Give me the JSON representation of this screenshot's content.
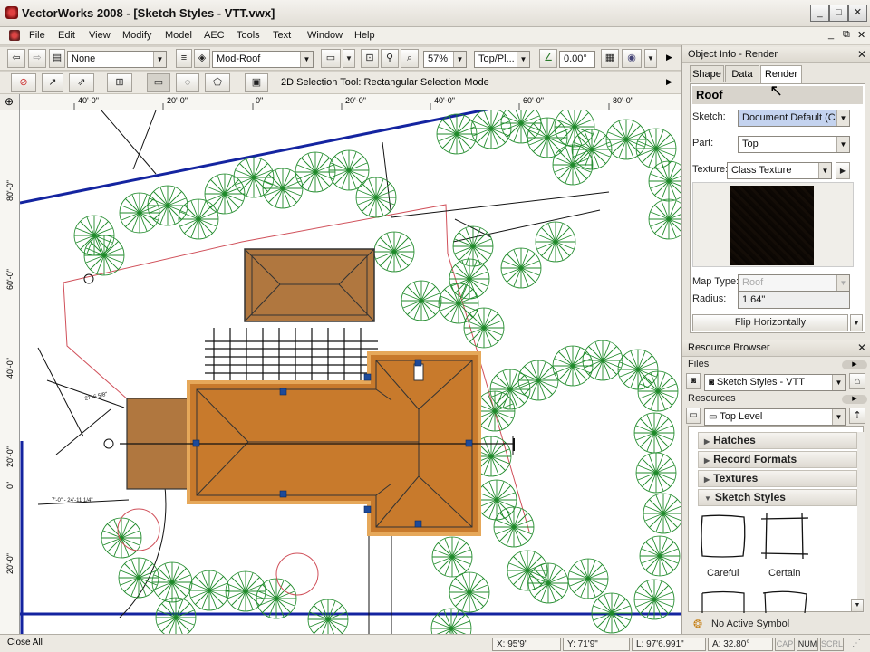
{
  "window": {
    "title": "VectorWorks 2008 - [Sketch Styles - VTT.vwx]"
  },
  "menu": [
    "File",
    "Edit",
    "View",
    "Modify",
    "Model",
    "AEC",
    "Tools",
    "Text",
    "Window",
    "Help"
  ],
  "toolbar1": {
    "class_value": "None",
    "layer_value": "Mod-Roof",
    "zoom_value": "57%",
    "view_value": "Top/Pl...",
    "angle_value": "0.00°"
  },
  "toolbar2": {
    "mode_text": "2D Selection Tool: Rectangular Selection Mode"
  },
  "ruler": {
    "h_ticks": [
      "40'-0\"",
      "20'-0\"",
      "0\"",
      "20'-0\"",
      "40'-0\"",
      "60'-0\"",
      "80'-0\""
    ],
    "v_ticks": [
      "80'-0\"",
      "60'-0\"",
      "40'-0\"",
      "20'-0\"",
      "0\"",
      "20'-0\""
    ]
  },
  "object_info": {
    "panel_title": "Object Info - Render",
    "tabs": [
      "Shape",
      "Data",
      "Render"
    ],
    "active_tab": "Render",
    "object_type": "Roof",
    "sketch_label": "Sketch:",
    "sketch_value": "Document Default (Cer",
    "part_label": "Part:",
    "part_value": "Top",
    "texture_label": "Texture:",
    "texture_value": "Class Texture",
    "map_type_label": "Map Type:",
    "map_type_value": "Roof",
    "radius_label": "Radius:",
    "radius_value": "1.64\"",
    "flip_label": "Flip Horizontally"
  },
  "resource_browser": {
    "panel_title": "Resource Browser",
    "files_label": "Files",
    "files_value": "Sketch Styles - VTT",
    "resources_label": "Resources",
    "resources_value": "Top Level",
    "categories": [
      "Hatches",
      "Record Formats",
      "Textures",
      "Sketch Styles"
    ],
    "sketch_styles": [
      "Careful",
      "Certain"
    ],
    "active_symbol": "No Active Symbol"
  },
  "status": {
    "left": "Close All",
    "x": "X: 95'9\"",
    "y": "Y: 71'9\"",
    "l": "L: 97'6.991\"",
    "a": "A: 32.80°",
    "indicators": [
      "CAP",
      "NUM",
      "SCRL"
    ]
  },
  "drawing_labels": [
    "27'-6 5/8\"",
    "7'-0\" - 24'-11 1/4\""
  ],
  "colors": {
    "roof_fill": "#b0773f",
    "roof_selected": "#c87a2c",
    "tree_green": "#1f8a2a",
    "property_blue": "#1424a0",
    "setback_red": "#d0505a"
  }
}
